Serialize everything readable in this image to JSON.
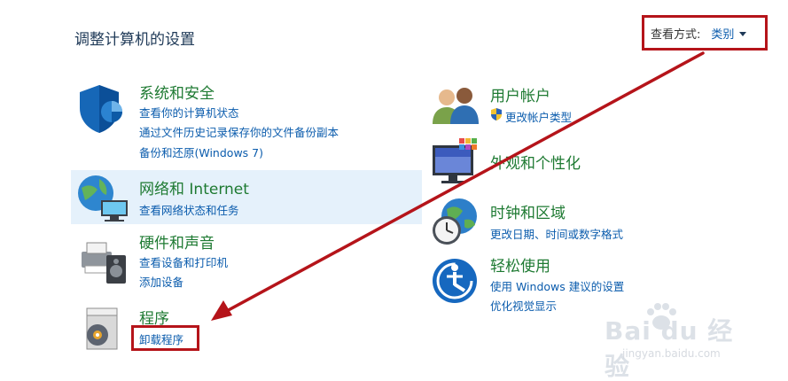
{
  "header": {
    "title": "调整计算机的设置",
    "view_by_label": "查看方式:",
    "view_by_value": "类别"
  },
  "categories_left": [
    {
      "title": "系统和安全",
      "links": [
        "查看你的计算机状态",
        "通过文件历史记录保存你的文件备份副本",
        "备份和还原(Windows 7)"
      ]
    },
    {
      "title": "网络和 Internet",
      "links": [
        "查看网络状态和任务"
      ]
    },
    {
      "title": "硬件和声音",
      "links": [
        "查看设备和打印机",
        "添加设备"
      ]
    },
    {
      "title": "程序",
      "links": [
        "卸载程序"
      ]
    }
  ],
  "categories_right": [
    {
      "title": "用户帐户",
      "links": [
        "更改帐户类型"
      ]
    },
    {
      "title": "外观和个性化",
      "links": []
    },
    {
      "title": "时钟和区域",
      "links": [
        "更改日期、时间或数字格式"
      ]
    },
    {
      "title": "轻松使用",
      "links": [
        "使用 Windows 建议的设置",
        "优化视觉显示"
      ]
    }
  ],
  "watermark": {
    "brand": "Bai du 经验",
    "url": "jingyan.baidu.com"
  },
  "colors": {
    "title_green": "#1e7a32",
    "link_blue": "#0b5cad",
    "annotation_red": "#b5141a",
    "highlight": "#e5f1fb"
  }
}
